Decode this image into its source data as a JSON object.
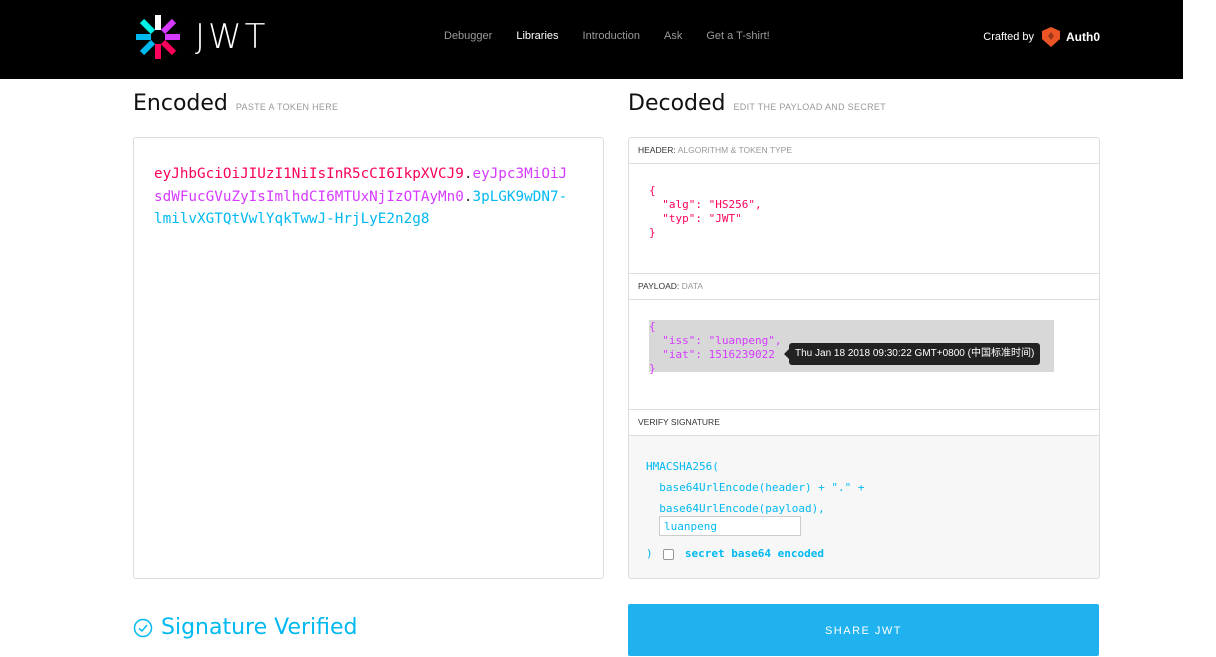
{
  "nav": {
    "logo_text": "JWT",
    "links": [
      "Debugger",
      "Libraries",
      "Introduction",
      "Ask",
      "Get a T-shirt!"
    ],
    "active_link": "Libraries",
    "crafted_by": "Crafted by",
    "auth0_label": "Auth0"
  },
  "encoded": {
    "title": "Encoded",
    "subtitle": "PASTE A TOKEN HERE",
    "token_header": "eyJhbGciOiJIUzI1NiIsInR5cCI6IkpXVCJ9",
    "token_payload": "eyJpc3MiOiJsdWFucGVuZyIsImlhdCI6MTUxNjIzOTAyMn0",
    "token_signature": "3pLGK9wDN7-lmilvXGTQtVwlYqkTwwJ-HrjLyE2n2g8",
    "dot": "."
  },
  "decoded": {
    "title": "Decoded",
    "subtitle": "EDIT THE PAYLOAD AND SECRET",
    "header_section": {
      "label": "HEADER:",
      "sublabel": "ALGORITHM & TOKEN TYPE",
      "lines": [
        "{",
        "  \"alg\": \"HS256\",",
        "  \"typ\": \"JWT\"",
        "}"
      ]
    },
    "payload_section": {
      "label": "PAYLOAD:",
      "sublabel": "DATA",
      "lines": [
        "{",
        "  \"iss\": \"luanpeng\",",
        "  \"iat\": 1516239022",
        "}"
      ],
      "tooltip": "Thu Jan 18 2018 09:30:22 GMT+0800 (中国标准时间)"
    },
    "verify_section": {
      "label": "VERIFY SIGNATURE",
      "line1": "HMACSHA256(",
      "line2": "  base64UrlEncode(header) + \".\" +",
      "line3": "  base64UrlEncode(payload),",
      "secret_value": "luanpeng",
      "close": ")",
      "checkbox_label": "secret base64 encoded"
    }
  },
  "footer": {
    "verified_text": "Signature Verified",
    "share_button": "SHARE JWT"
  },
  "colors": {
    "header": "#fb015b",
    "payload": "#d63aff",
    "signature": "#00b9f1",
    "share_button": "#1fb2ef"
  }
}
